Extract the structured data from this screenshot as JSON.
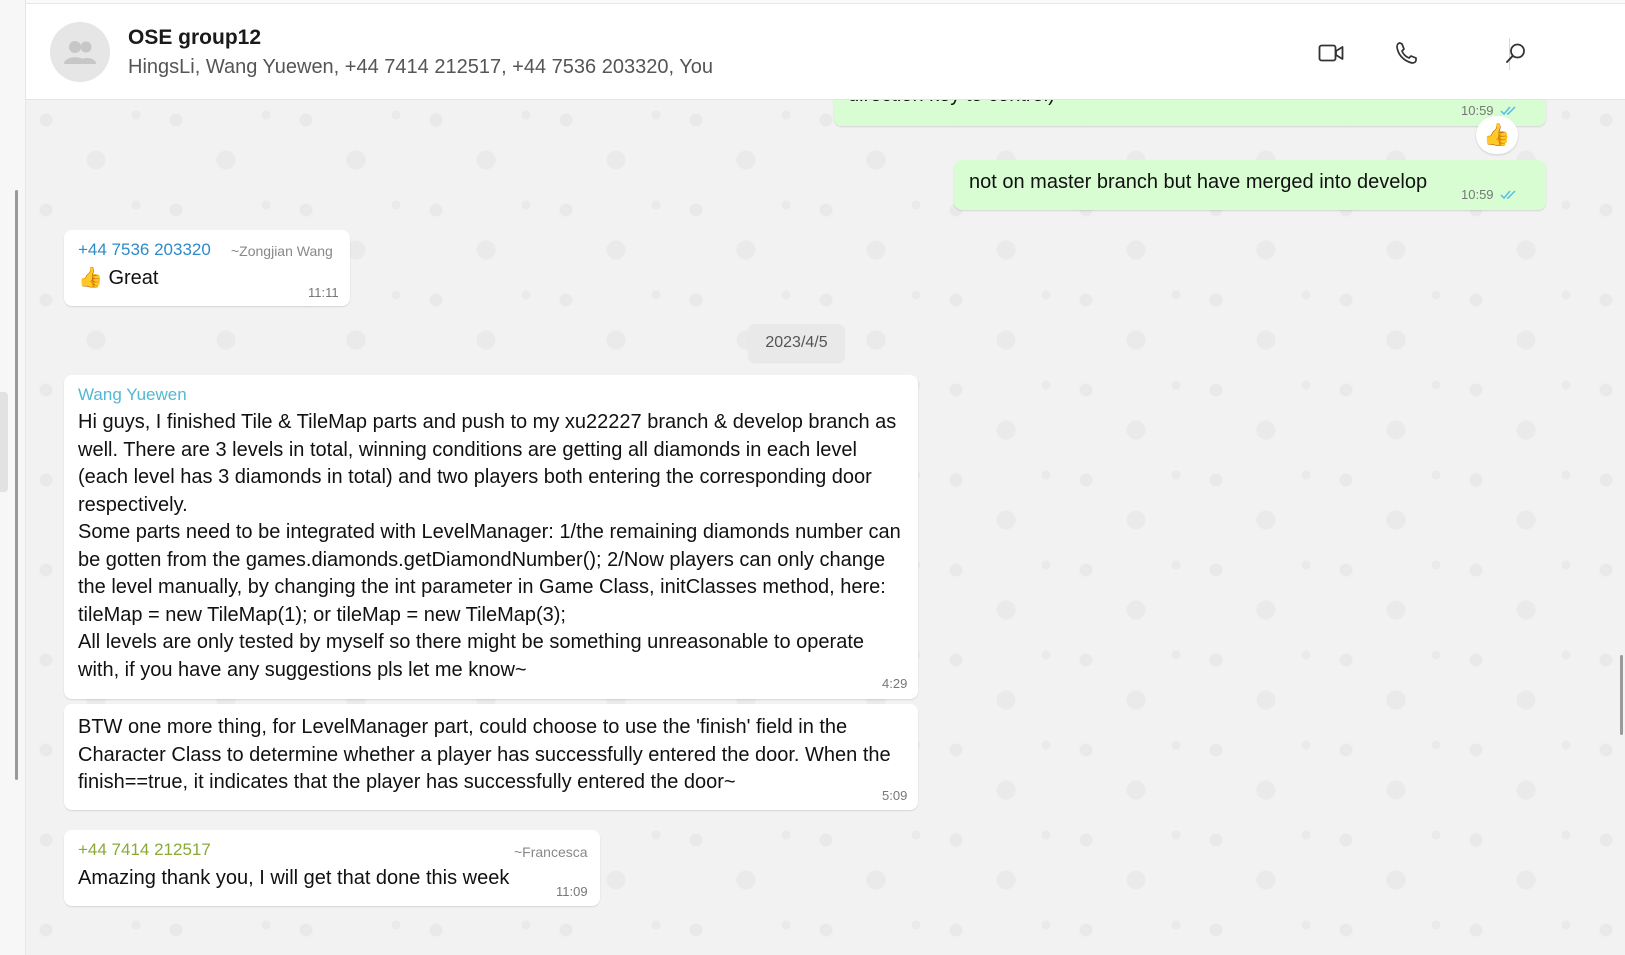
{
  "header": {
    "title": "OSE group12",
    "members": "HingsLi, Wang Yuewen, +44 7414 212517, +44 7536 203320, You"
  },
  "icons": {
    "avatar": "group-icon",
    "video": "video-call-icon",
    "voice": "phone-icon",
    "search": "search-icon"
  },
  "messages": {
    "m1": {
      "text": "direction key to control)",
      "time": "10:59",
      "status": "read"
    },
    "m1_reaction": "👍",
    "m2": {
      "text": "not on master branch but have merged into develop",
      "time": "10:59",
      "status": "read"
    },
    "m3": {
      "sender": "+44 7536 203320",
      "alias": "~Zongjian Wang",
      "text": "👍 Great",
      "time": "11:11"
    },
    "date": "2023/4/5",
    "m4": {
      "sender": "Wang Yuewen",
      "text": "Hi guys, I finished Tile & TileMap parts and push to my xu22227 branch & develop branch as well. There are 3 levels in total, winning conditions are getting all diamonds in each level (each level has 3 diamonds in total) and two players both entering the corresponding door respectively.\nSome parts need to be integrated with LevelManager: 1/the remaining diamonds number can be gotten from the games.diamonds.getDiamondNumber(); 2/Now players can only change the level manually, by changing the int parameter in Game Class, initClasses method, here: tileMap = new TileMap(1); or tileMap = new TileMap(3);\nAll levels are only tested by myself so there might be something unreasonable to operate with, if you have any suggestions pls let me know~",
      "time": "4:29"
    },
    "m5": {
      "text": "BTW one more thing, for LevelManager part, could choose to use the 'finish' field in the Character Class to determine whether a player has successfully entered the door. When the finish==true, it indicates that the player has successfully entered the door~",
      "time": "5:09"
    },
    "m6": {
      "sender": "+44 7414 212517",
      "alias": "~Francesca",
      "text": "Amazing thank you, I will get that done this week",
      "time": "11:09"
    }
  },
  "colors": {
    "outgoing_bubble": "#d9fdd3",
    "incoming_bubble": "#ffffff",
    "sender_blue": "#2e8bc9",
    "sender_teal": "#53b8d1",
    "sender_olive": "#8aa937",
    "read_ticks": "#53bdeb"
  }
}
